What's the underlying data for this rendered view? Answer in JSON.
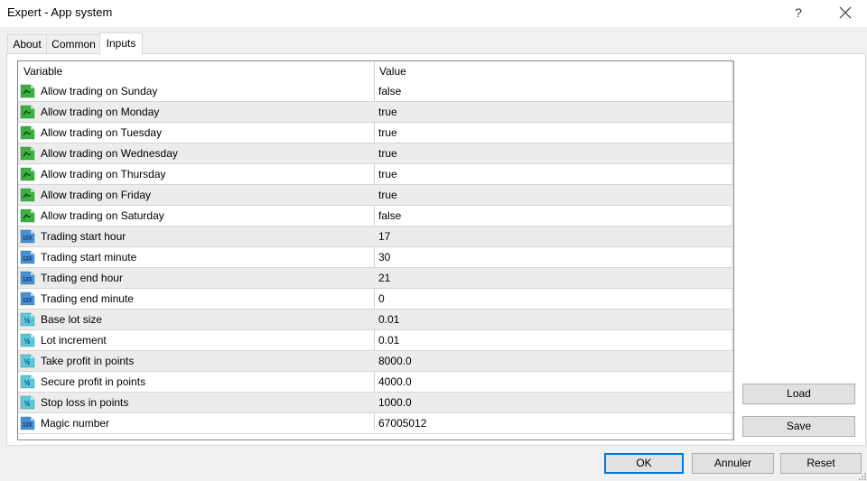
{
  "window": {
    "title": "Expert - App system",
    "help_label": "?",
    "close_icon": "close-icon"
  },
  "tabs": [
    {
      "label": "About",
      "active": false
    },
    {
      "label": "Common",
      "active": false
    },
    {
      "label": "Inputs",
      "active": true
    }
  ],
  "grid": {
    "columns": {
      "variable": "Variable",
      "value": "Value"
    },
    "rows": [
      {
        "icon": "bool-icon",
        "name": "Allow trading on Sunday",
        "value": "false"
      },
      {
        "icon": "bool-icon",
        "name": "Allow trading on Monday",
        "value": "true"
      },
      {
        "icon": "bool-icon",
        "name": "Allow trading on Tuesday",
        "value": "true"
      },
      {
        "icon": "bool-icon",
        "name": "Allow trading on Wednesday",
        "value": "true"
      },
      {
        "icon": "bool-icon",
        "name": "Allow trading on Thursday",
        "value": "true"
      },
      {
        "icon": "bool-icon",
        "name": "Allow trading on Friday",
        "value": "true"
      },
      {
        "icon": "bool-icon",
        "name": "Allow trading on Saturday",
        "value": "false"
      },
      {
        "icon": "integer-icon",
        "name": "Trading start hour",
        "value": "17"
      },
      {
        "icon": "integer-icon",
        "name": "Trading start minute",
        "value": "30"
      },
      {
        "icon": "integer-icon",
        "name": "Trading end hour",
        "value": "21"
      },
      {
        "icon": "integer-icon",
        "name": "Trading end minute",
        "value": "0"
      },
      {
        "icon": "double-icon",
        "name": "Base lot size",
        "value": "0.01"
      },
      {
        "icon": "double-icon",
        "name": "Lot increment",
        "value": "0.01"
      },
      {
        "icon": "double-icon",
        "name": "Take profit in points",
        "value": "8000.0"
      },
      {
        "icon": "double-icon",
        "name": "Secure profit in points",
        "value": "4000.0"
      },
      {
        "icon": "double-icon",
        "name": "Stop loss in points",
        "value": "1000.0"
      },
      {
        "icon": "integer-icon",
        "name": "Magic number",
        "value": "67005012"
      }
    ]
  },
  "side_buttons": {
    "load": "Load",
    "save": "Save"
  },
  "footer_buttons": {
    "ok": "OK",
    "cancel": "Annuler",
    "reset": "Reset"
  },
  "icon_glyphs": {
    "integer": "123",
    "double": "½"
  },
  "colors": {
    "accent": "#0078d7",
    "bool_icon": "#3cb043",
    "integer_icon": "#4a90d9",
    "double_icon": "#5bc8e0"
  }
}
